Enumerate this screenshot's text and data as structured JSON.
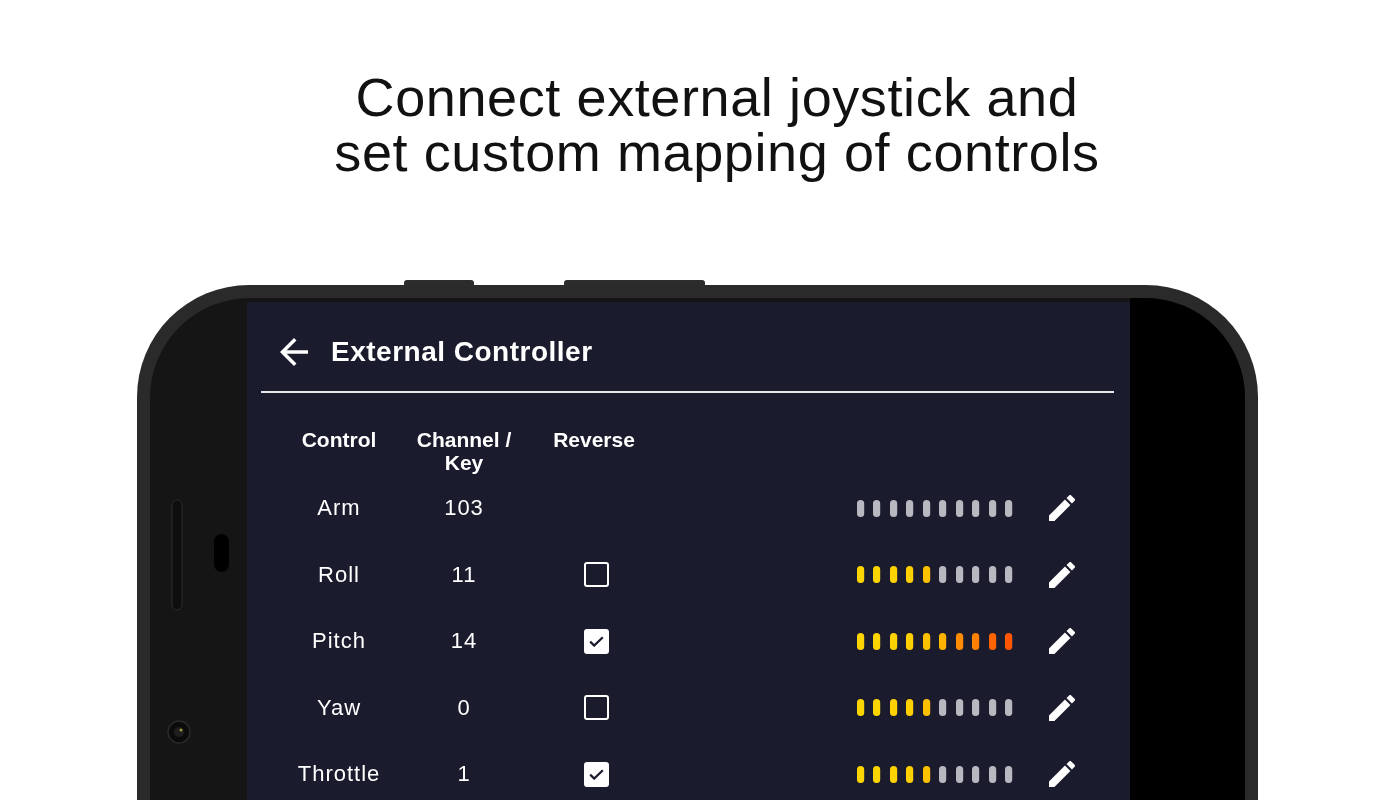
{
  "headline": "Connect external joystick and\nset custom mapping of controls",
  "app_bar": {
    "title": "External Controller"
  },
  "table": {
    "columns": [
      "Control",
      "Channel / Key",
      "Reverse"
    ],
    "rows": [
      {
        "control": "Arm",
        "channel": "103",
        "kind": "button",
        "on": false
      },
      {
        "control": "Roll",
        "channel": "11",
        "kind": "axis",
        "checked": false,
        "level": 0.5
      },
      {
        "control": "Pitch",
        "channel": "14",
        "kind": "axis",
        "checked": true,
        "level": 1
      },
      {
        "control": "Yaw",
        "channel": "0",
        "kind": "axis",
        "checked": false,
        "level": 0.5
      },
      {
        "control": "Throttle",
        "channel": "1",
        "kind": "axis",
        "checked": true,
        "level": 0.5
      }
    ]
  }
}
